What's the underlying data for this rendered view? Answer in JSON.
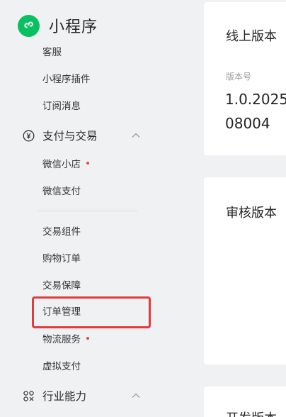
{
  "brand": {
    "title": "小程序",
    "logo_icon": "mini-program-logo-icon",
    "logo_color": "#07c160"
  },
  "sidebar": {
    "items_top": [
      {
        "label": "客服"
      },
      {
        "label": "小程序插件"
      },
      {
        "label": "订阅消息"
      }
    ],
    "payment_group": {
      "label": "支付与交易",
      "icon": "yen-circle-icon",
      "items_a": [
        {
          "label": "微信小店",
          "dot": true
        },
        {
          "label": "微信支付",
          "dot": false
        }
      ],
      "items_b": [
        {
          "label": "交易组件",
          "dot": false
        },
        {
          "label": "购物订单",
          "dot": false
        },
        {
          "label": "交易保障",
          "dot": false
        },
        {
          "label": "订单管理",
          "dot": false,
          "highlighted": true
        },
        {
          "label": "物流服务",
          "dot": true
        },
        {
          "label": "虚拟支付",
          "dot": false
        }
      ]
    },
    "industry_group": {
      "label": "行业能力",
      "icon": "industry-nodes-icon"
    }
  },
  "cards": {
    "online": {
      "title": "线上版本",
      "version_label": "版本号",
      "version_value": "1.0.2025 08004"
    },
    "review": {
      "title": "审核版本"
    },
    "dev": {
      "title": "开发版本"
    }
  },
  "colors": {
    "accent_red": "#e5393e",
    "dot_red": "#e5463f",
    "sidebar_bg": "#f0f1f3"
  }
}
